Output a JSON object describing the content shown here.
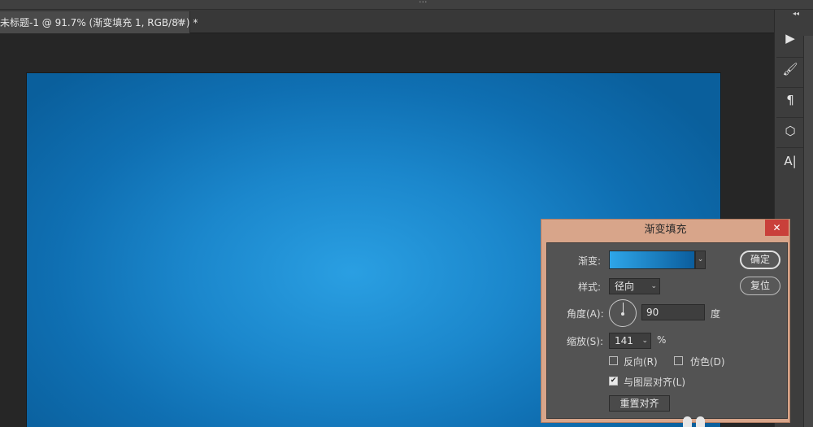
{
  "window": {
    "title": "..."
  },
  "document_tab": {
    "label": "未标题-1 @ 91.7% (渐变填充 1, RGB/8#) *",
    "close_glyph": "×"
  },
  "right_panel": {
    "collapse_glyph": "◂◂",
    "tools": [
      {
        "name": "play-icon",
        "glyph": "▶"
      },
      {
        "name": "brush-icon",
        "glyph": "🖌"
      },
      {
        "name": "paragraph-icon",
        "glyph": "¶"
      },
      {
        "name": "cube-icon",
        "glyph": "⬡"
      },
      {
        "name": "character-icon",
        "glyph": "A|"
      }
    ]
  },
  "canvas": {
    "gradient_center": "#2a9fe2",
    "gradient_edge": "#0a5f9c"
  },
  "dialog": {
    "title": "渐变填充",
    "close_glyph": "✕",
    "gradient_label": "渐变:",
    "style_label": "样式:",
    "style_value": "径向",
    "angle_label": "角度(A):",
    "angle_value": "90",
    "angle_unit": "度",
    "scale_label": "缩放(S):",
    "scale_value": "141",
    "scale_unit": "%",
    "reverse_label": "反向(R)",
    "reverse_checked": false,
    "dither_label": "仿色(D)",
    "dither_checked": false,
    "align_label": "与图层对齐(L)",
    "align_checked": true,
    "reset_align_label": "重置对齐",
    "ok_label": "确定",
    "reset_label": "复位",
    "caret_glyph": "⌄",
    "check_glyph": "✔"
  },
  "colors": {
    "accent": "#c9403a",
    "dialog_frame": "#d8a58a",
    "gradient_start": "#2ea6e8",
    "gradient_end": "#0b5d9d"
  }
}
